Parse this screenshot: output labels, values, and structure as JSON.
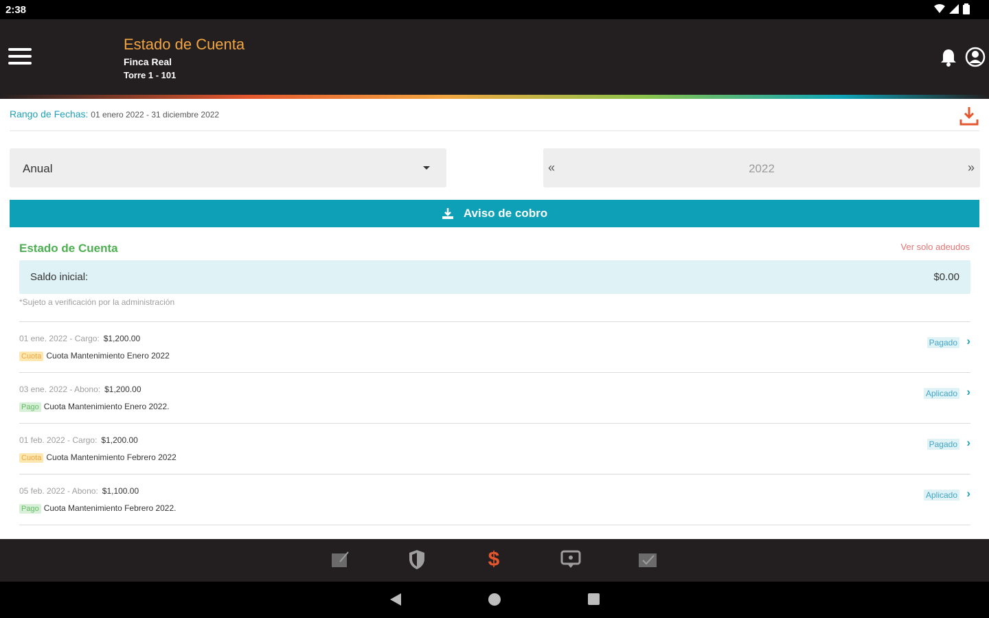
{
  "status_bar": {
    "time": "2:38"
  },
  "header": {
    "title": "Estado de Cuenta",
    "subtitle": "Finca Real",
    "unit": "Torre 1 - 101"
  },
  "range": {
    "label": "Rango de Fechas:",
    "value": "01 enero 2022 - 31 diciembre 2022"
  },
  "period_select": {
    "value": "Anual"
  },
  "year_picker": {
    "prev": "«",
    "year": "2022",
    "next": "»"
  },
  "aviso_button": {
    "label": "Aviso de cobro"
  },
  "section": {
    "title": "Estado de Cuenta",
    "filter_link": "Ver solo adeudos",
    "saldo_label": "Saldo inicial:",
    "saldo_value": "$0.00",
    "note": "*Sujeto a verificación por la administración"
  },
  "movements": [
    {
      "date": "01 ene. 2022 - Cargo:",
      "amount": "$1,200.00",
      "tag": "Cuota",
      "desc": "Cuota Mantenimiento Enero 2022",
      "status": "Pagado"
    },
    {
      "date": "03 ene. 2022 - Abono:",
      "amount": "$1,200.00",
      "tag": "Pago",
      "desc": "Cuota Mantenimiento Enero 2022.",
      "status": "Aplicado"
    },
    {
      "date": "01 feb. 2022 - Cargo:",
      "amount": "$1,200.00",
      "tag": "Cuota",
      "desc": "Cuota Mantenimiento Febrero 2022",
      "status": "Pagado"
    },
    {
      "date": "05 feb. 2022 - Abono:",
      "amount": "$1,100.00",
      "tag": "Pago",
      "desc": "Cuota Mantenimiento Febrero 2022.",
      "status": "Aplicado"
    }
  ],
  "bottom_nav": {
    "items": [
      "notes-icon",
      "shield-icon",
      "dollar-icon",
      "message-icon",
      "checklist-icon"
    ],
    "active_symbol": "$",
    "active_color": "#e4572e"
  },
  "colors": {
    "accent": "#0ea0b6",
    "title": "#f2a541",
    "section": "#4caf50",
    "alert": "#e57373"
  }
}
